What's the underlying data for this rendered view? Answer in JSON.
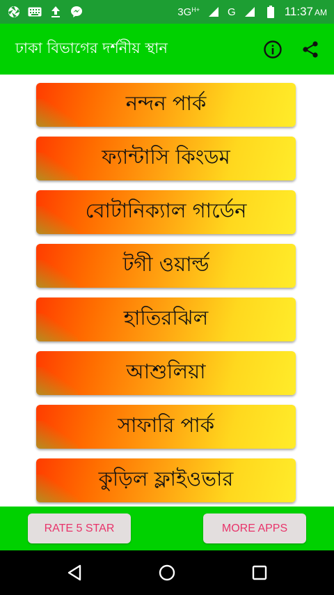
{
  "status_bar": {
    "network_label": "3G",
    "network_sub": "H+",
    "carrier_label": "G",
    "time": "11:37",
    "ampm": "AM"
  },
  "app_bar": {
    "title": "ঢাকা বিভাগের দর্শনীয় স্থান"
  },
  "places": [
    {
      "label": "নন্দন পার্ক"
    },
    {
      "label": "ফ্যান্টাসি কিংডম"
    },
    {
      "label": "বোটানিক্যাল গার্ডেন"
    },
    {
      "label": "টগী ওয়ার্ল্ড"
    },
    {
      "label": "হাতিরঝিল"
    },
    {
      "label": "আশুলিয়া"
    },
    {
      "label": "সাফারি পার্ক"
    },
    {
      "label": "কুড়িল ফ্লাইওভার"
    }
  ],
  "bottom": {
    "rate_label": "RATE 5 STAR",
    "more_label": "MORE APPS"
  },
  "colors": {
    "status_bar": "#1d9e33",
    "app_bar": "#00d100",
    "button_text": "#e8336a"
  }
}
